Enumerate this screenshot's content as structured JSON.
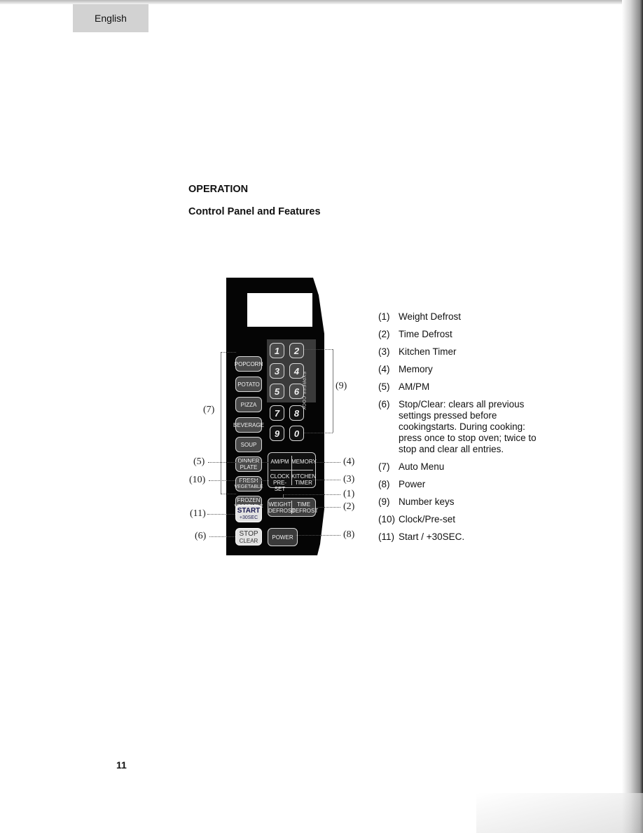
{
  "header": {
    "language_tab": "English"
  },
  "section": {
    "title": "OPERATION",
    "subtitle": "Control Panel and Features"
  },
  "panel": {
    "menu_buttons": [
      {
        "id": "popcorn",
        "lines": [
          "POPCORN"
        ]
      },
      {
        "id": "potato",
        "lines": [
          "POTATO"
        ]
      },
      {
        "id": "pizza",
        "lines": [
          "PIZZA"
        ]
      },
      {
        "id": "beverage",
        "lines": [
          "BEVERAGE"
        ]
      },
      {
        "id": "soup",
        "lines": [
          "SOUP"
        ]
      },
      {
        "id": "dinner-plate",
        "lines": [
          "DINNER",
          "PLATE"
        ]
      },
      {
        "id": "fresh-vegetable",
        "lines": [
          "FRESH",
          "VEGETABLE"
        ]
      },
      {
        "id": "frozen-vegetable",
        "lines": [
          "FROZEN",
          "VEGETABLE"
        ]
      }
    ],
    "number_keys": [
      "1",
      "2",
      "3",
      "4",
      "5",
      "6",
      "7",
      "8",
      "9",
      "0"
    ],
    "express_cook_label": "EXPRESS COOK",
    "ampm_label": "AM/PM",
    "memory_label": "MEMORY",
    "clock_label": [
      "CLOCK",
      "PRE-SET"
    ],
    "kitchen_timer_label": [
      "KITCHEN",
      "TIMER"
    ],
    "weight_defrost_label": [
      "WEIGHT",
      "DEFROST"
    ],
    "time_defrost_label": [
      "TIME",
      "DEFROST"
    ],
    "start_label": [
      "START",
      "+30SEC"
    ],
    "stop_label": [
      "STOP",
      "CLEAR"
    ],
    "power_label": "POWER"
  },
  "callouts": {
    "c1": "(1)",
    "c2": "(2)",
    "c3": "(3)",
    "c4": "(4)",
    "c5": "(5)",
    "c6": "(6)",
    "c7": "(7)",
    "c8": "(8)",
    "c9": "(9)",
    "c10": "(10)",
    "c11": "(11)"
  },
  "legend": [
    {
      "num": "(1)",
      "text": "Weight Defrost"
    },
    {
      "num": "(2)",
      "text": "Time Defrost"
    },
    {
      "num": "(3)",
      "text": "Kitchen Timer"
    },
    {
      "num": "(4)",
      "text": "Memory"
    },
    {
      "num": "(5)",
      "text": "AM/PM"
    },
    {
      "num": "(6)",
      "text": "Stop/Clear: clears all previous settings pressed before cookingstarts. During cooking: press once to stop oven; twice to stop and clear all entries."
    },
    {
      "num": "(7)",
      "text": "Auto Menu"
    },
    {
      "num": "(8)",
      "text": "Power"
    },
    {
      "num": "(9)",
      "text": "Number keys"
    },
    {
      "num": "(10)",
      "text": "Clock/Pre-set"
    },
    {
      "num": "(11)",
      "text": "Start / +30SEC."
    }
  ],
  "footer": {
    "page_number": "11"
  }
}
